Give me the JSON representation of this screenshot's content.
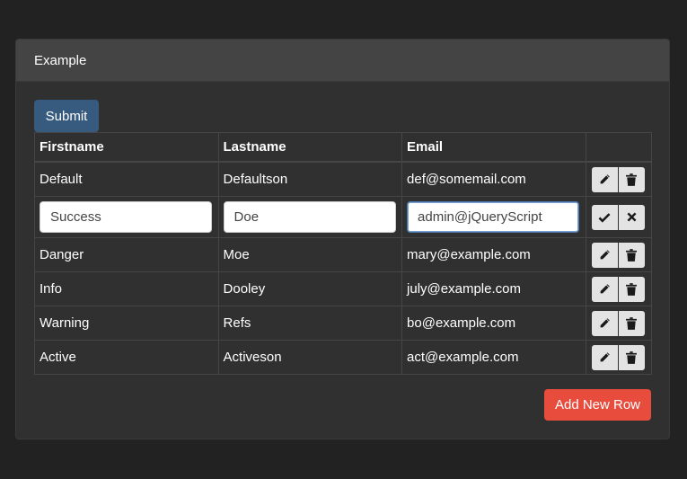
{
  "panel": {
    "title": "Example"
  },
  "toolbar": {
    "submit_label": "Submit",
    "add_row_label": "Add New Row"
  },
  "table": {
    "headers": {
      "firstname": "Firstname",
      "lastname": "Lastname",
      "email": "Email"
    },
    "rows": [
      {
        "firstname": "Default",
        "lastname": "Defaultson",
        "email": "def@somemail.com"
      },
      {
        "firstname": "Success",
        "lastname": "Doe",
        "email": "admin@jQueryScript",
        "editing": true
      },
      {
        "firstname": "Danger",
        "lastname": "Moe",
        "email": "mary@example.com"
      },
      {
        "firstname": "Info",
        "lastname": "Dooley",
        "email": "july@example.com"
      },
      {
        "firstname": "Warning",
        "lastname": "Refs",
        "email": "bo@example.com"
      },
      {
        "firstname": "Active",
        "lastname": "Activeson",
        "email": "act@example.com"
      }
    ]
  },
  "icons": {
    "edit": "pencil-icon",
    "delete": "trash-icon",
    "save": "check-icon",
    "cancel": "close-icon"
  },
  "colors": {
    "background": "#222222",
    "panel": "#303030",
    "panel_heading": "#444444",
    "primary": "#375a7f",
    "danger": "#e74c3c",
    "action_button": "#e3e3e3"
  }
}
